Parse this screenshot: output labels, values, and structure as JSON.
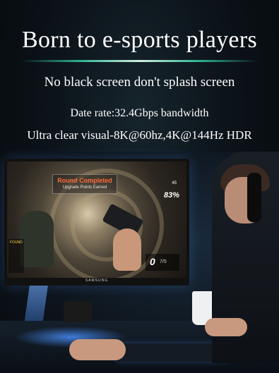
{
  "headline": "Born to e-sports players",
  "line1": "No black screen don't splash screen",
  "line2": "Date rate:32.4Gbps bandwidth",
  "line3": "Ultra clear visual-8K@60hz,4K@144Hz HDR",
  "game_hud": {
    "title": "Round Completed",
    "subtitle": "Upgrade Points Earned",
    "stat": "45",
    "percent": "83%",
    "ammo": "0",
    "ammo_max": "7/5",
    "left_label": "FOUND"
  },
  "monitor_brand": "SAMSUNG",
  "colors": {
    "accent": "#2fb38f",
    "hud_title": "#ff6b3d",
    "text": "#ffffff"
  }
}
